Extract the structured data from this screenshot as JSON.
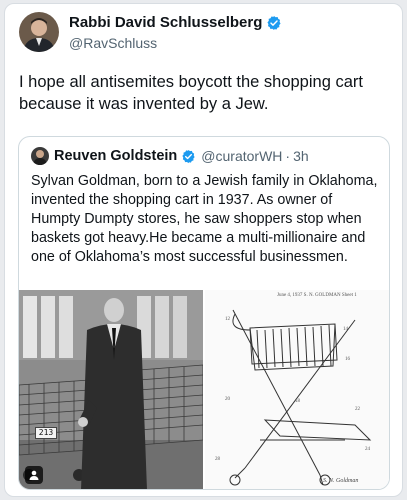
{
  "tweet": {
    "author_name": "Rabbi David Schlusselberg",
    "author_handle": "@RavSchluss",
    "text": "I hope all antisemites boycott the shopping cart because it was invented by a Jew."
  },
  "quoted_tweet": {
    "author_name": "Reuven Goldstein",
    "author_handle": "@curatorWH",
    "separator": "·",
    "time": "3h",
    "text": "Sylvan Goldman, born to a Jewish family in Oklahoma, invented the shopping cart in 1937. As owner of Humpty Dumpty stores, he saw shoppers stop when baskets got heavy.He became a multi-millionaire and one of Oklahoma’s most successful businessmen."
  },
  "media": {
    "photo_cart_tag": "213",
    "patent_header": "June 4, 1937     S. N. GOLDMAN     Sheet 1",
    "patent_signature": "S. N. Goldman"
  },
  "colors": {
    "verified_blue": "#1d9bf0",
    "secondary_text": "#536471",
    "primary_text": "#0f1419",
    "border": "#cfd9de"
  },
  "icons": [
    "verified-badge-icon",
    "person-tag-icon"
  ]
}
